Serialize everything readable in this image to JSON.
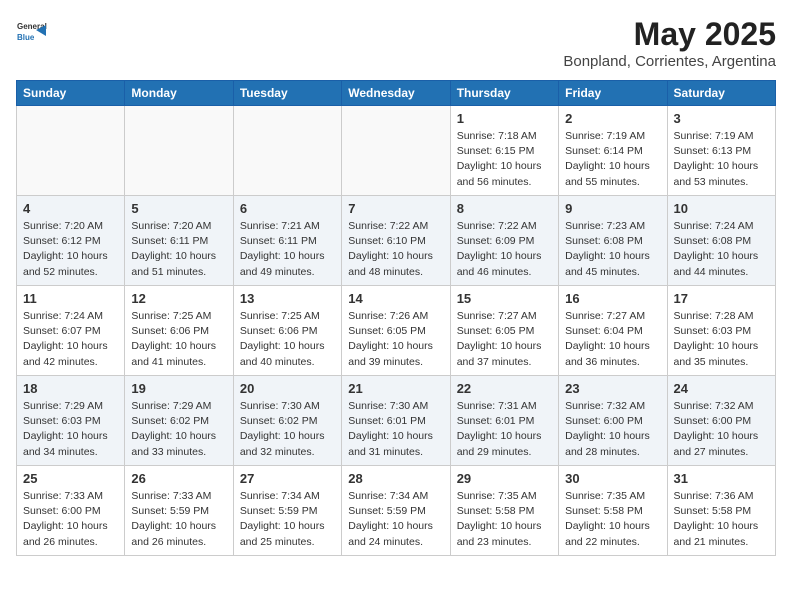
{
  "logo": {
    "general": "General",
    "blue": "Blue"
  },
  "title": "May 2025",
  "location": "Bonpland, Corrientes, Argentina",
  "weekdays": [
    "Sunday",
    "Monday",
    "Tuesday",
    "Wednesday",
    "Thursday",
    "Friday",
    "Saturday"
  ],
  "weeks": [
    [
      {
        "day": "",
        "info": ""
      },
      {
        "day": "",
        "info": ""
      },
      {
        "day": "",
        "info": ""
      },
      {
        "day": "",
        "info": ""
      },
      {
        "day": "1",
        "info": "Sunrise: 7:18 AM\nSunset: 6:15 PM\nDaylight: 10 hours\nand 56 minutes."
      },
      {
        "day": "2",
        "info": "Sunrise: 7:19 AM\nSunset: 6:14 PM\nDaylight: 10 hours\nand 55 minutes."
      },
      {
        "day": "3",
        "info": "Sunrise: 7:19 AM\nSunset: 6:13 PM\nDaylight: 10 hours\nand 53 minutes."
      }
    ],
    [
      {
        "day": "4",
        "info": "Sunrise: 7:20 AM\nSunset: 6:12 PM\nDaylight: 10 hours\nand 52 minutes."
      },
      {
        "day": "5",
        "info": "Sunrise: 7:20 AM\nSunset: 6:11 PM\nDaylight: 10 hours\nand 51 minutes."
      },
      {
        "day": "6",
        "info": "Sunrise: 7:21 AM\nSunset: 6:11 PM\nDaylight: 10 hours\nand 49 minutes."
      },
      {
        "day": "7",
        "info": "Sunrise: 7:22 AM\nSunset: 6:10 PM\nDaylight: 10 hours\nand 48 minutes."
      },
      {
        "day": "8",
        "info": "Sunrise: 7:22 AM\nSunset: 6:09 PM\nDaylight: 10 hours\nand 46 minutes."
      },
      {
        "day": "9",
        "info": "Sunrise: 7:23 AM\nSunset: 6:08 PM\nDaylight: 10 hours\nand 45 minutes."
      },
      {
        "day": "10",
        "info": "Sunrise: 7:24 AM\nSunset: 6:08 PM\nDaylight: 10 hours\nand 44 minutes."
      }
    ],
    [
      {
        "day": "11",
        "info": "Sunrise: 7:24 AM\nSunset: 6:07 PM\nDaylight: 10 hours\nand 42 minutes."
      },
      {
        "day": "12",
        "info": "Sunrise: 7:25 AM\nSunset: 6:06 PM\nDaylight: 10 hours\nand 41 minutes."
      },
      {
        "day": "13",
        "info": "Sunrise: 7:25 AM\nSunset: 6:06 PM\nDaylight: 10 hours\nand 40 minutes."
      },
      {
        "day": "14",
        "info": "Sunrise: 7:26 AM\nSunset: 6:05 PM\nDaylight: 10 hours\nand 39 minutes."
      },
      {
        "day": "15",
        "info": "Sunrise: 7:27 AM\nSunset: 6:05 PM\nDaylight: 10 hours\nand 37 minutes."
      },
      {
        "day": "16",
        "info": "Sunrise: 7:27 AM\nSunset: 6:04 PM\nDaylight: 10 hours\nand 36 minutes."
      },
      {
        "day": "17",
        "info": "Sunrise: 7:28 AM\nSunset: 6:03 PM\nDaylight: 10 hours\nand 35 minutes."
      }
    ],
    [
      {
        "day": "18",
        "info": "Sunrise: 7:29 AM\nSunset: 6:03 PM\nDaylight: 10 hours\nand 34 minutes."
      },
      {
        "day": "19",
        "info": "Sunrise: 7:29 AM\nSunset: 6:02 PM\nDaylight: 10 hours\nand 33 minutes."
      },
      {
        "day": "20",
        "info": "Sunrise: 7:30 AM\nSunset: 6:02 PM\nDaylight: 10 hours\nand 32 minutes."
      },
      {
        "day": "21",
        "info": "Sunrise: 7:30 AM\nSunset: 6:01 PM\nDaylight: 10 hours\nand 31 minutes."
      },
      {
        "day": "22",
        "info": "Sunrise: 7:31 AM\nSunset: 6:01 PM\nDaylight: 10 hours\nand 29 minutes."
      },
      {
        "day": "23",
        "info": "Sunrise: 7:32 AM\nSunset: 6:00 PM\nDaylight: 10 hours\nand 28 minutes."
      },
      {
        "day": "24",
        "info": "Sunrise: 7:32 AM\nSunset: 6:00 PM\nDaylight: 10 hours\nand 27 minutes."
      }
    ],
    [
      {
        "day": "25",
        "info": "Sunrise: 7:33 AM\nSunset: 6:00 PM\nDaylight: 10 hours\nand 26 minutes."
      },
      {
        "day": "26",
        "info": "Sunrise: 7:33 AM\nSunset: 5:59 PM\nDaylight: 10 hours\nand 26 minutes."
      },
      {
        "day": "27",
        "info": "Sunrise: 7:34 AM\nSunset: 5:59 PM\nDaylight: 10 hours\nand 25 minutes."
      },
      {
        "day": "28",
        "info": "Sunrise: 7:34 AM\nSunset: 5:59 PM\nDaylight: 10 hours\nand 24 minutes."
      },
      {
        "day": "29",
        "info": "Sunrise: 7:35 AM\nSunset: 5:58 PM\nDaylight: 10 hours\nand 23 minutes."
      },
      {
        "day": "30",
        "info": "Sunrise: 7:35 AM\nSunset: 5:58 PM\nDaylight: 10 hours\nand 22 minutes."
      },
      {
        "day": "31",
        "info": "Sunrise: 7:36 AM\nSunset: 5:58 PM\nDaylight: 10 hours\nand 21 minutes."
      }
    ]
  ]
}
